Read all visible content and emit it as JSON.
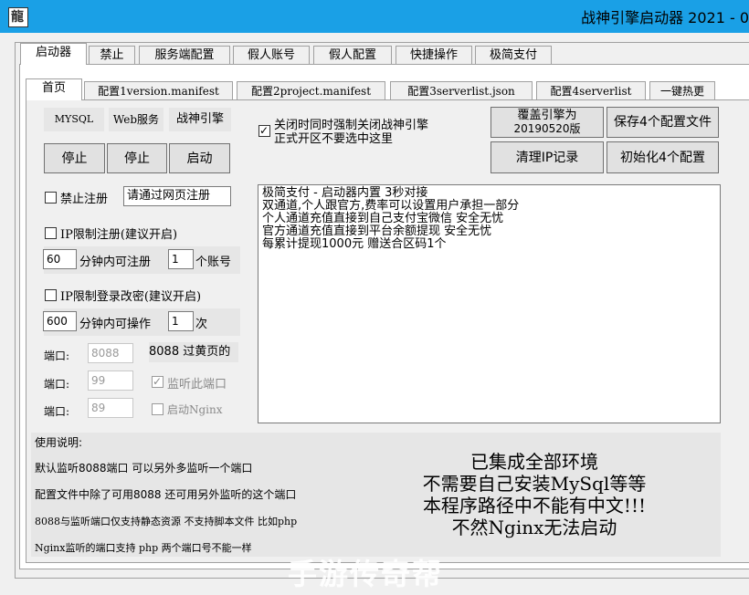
{
  "window": {
    "title": "战神引擎启动器 2021 - 0",
    "icon_letter": "龍"
  },
  "main_tabs": [
    "启动器",
    "禁止",
    "服务端配置",
    "假人账号",
    "假人配置",
    "快捷操作",
    "极简支付"
  ],
  "sub_tabs": [
    "首页",
    "配置1version.manifest",
    "配置2project.manifest",
    "配置3serverlist.json",
    "配置4serverlist",
    "一键热更"
  ],
  "services": {
    "mysql": "MYSQL",
    "web": "Web服务",
    "engine": "战神引擎",
    "stop1": "停止",
    "stop2": "停止",
    "start": "启动"
  },
  "options": {
    "force_close": "关闭时同时强制关闭战神引擎",
    "force_close_note": "正式开区不要选中这里"
  },
  "buttons": {
    "cover_line1": "覆盖引擎为",
    "cover_line2": "20190520版",
    "save4": "保存4个配置文件",
    "clear_ip": "清理IP记录",
    "init4": "初始化4个配置"
  },
  "register": {
    "ban_label": "禁止注册",
    "ban_value": "请通过网页注册",
    "ip_limit_label": "IP限制注册(建议开启)",
    "ip_minutes": "60",
    "ip_text": "分钟内可注册",
    "ip_count": "1",
    "ip_unit": "个账号"
  },
  "login": {
    "label": "IP限制登录改密(建议开启)",
    "minutes": "600",
    "text": "分钟内可操作",
    "count": "1",
    "unit": "次"
  },
  "ports": {
    "label": "端口:",
    "p1": "8088",
    "p1_note": "8088 过黄页的",
    "p2": "99",
    "p2_check": "监听此端口",
    "p3": "89",
    "p3_check": "启动Nginx"
  },
  "memo_lines": [
    "极简支付 - 启动器内置 3秒对接",
    "双通道,个人跟官方,费率可以设置用户承担一部分",
    "个人通道充值直接到自己支付宝微信 安全无忧",
    "官方通道充值直接到平台余额提现 安全无忧",
    "每累计提现1000元 赠送合区码1个"
  ],
  "usage": {
    "title": "使用说明:",
    "lines": [
      "默认监听8088端口 可以另外多监听一个端口",
      "配置文件中除了可用8088 还可用另外监听的这个端口",
      "8088与监听端口仅支持静态资源 不支持脚本文件 比如php",
      "Nginx监听的端口支持 php 两个端口号不能一样"
    ]
  },
  "notice": [
    "已集成全部环境",
    "不需要自己安装MySql等等",
    "本程序路径中不能有中文!!!",
    "不然Nginx无法启动"
  ],
  "watermark": "手游传奇帮"
}
